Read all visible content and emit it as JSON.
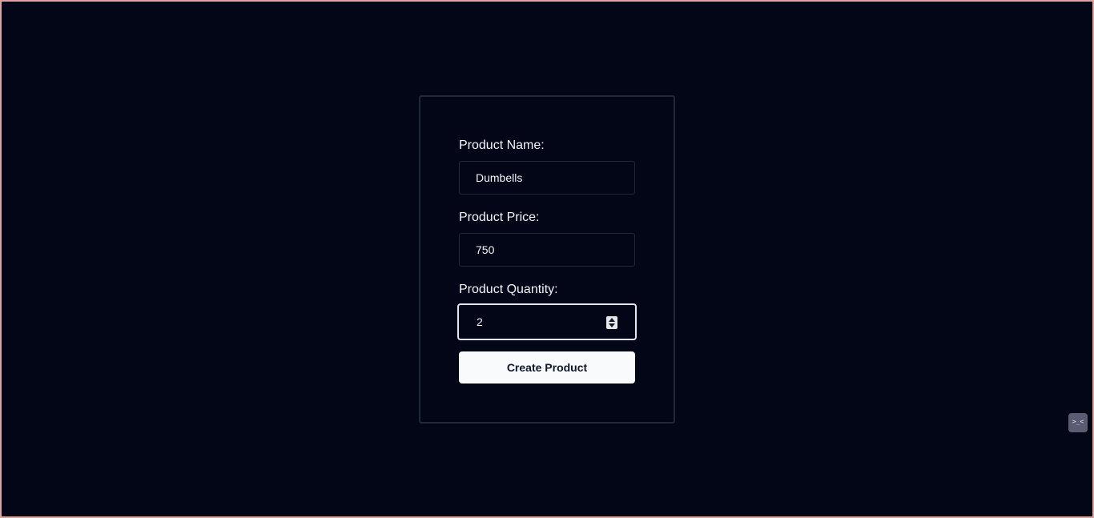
{
  "form": {
    "name_label": "Product Name:",
    "name_value": "Dumbells",
    "price_label": "Product Price:",
    "price_value": "750",
    "quantity_label": "Product Quantity:",
    "quantity_value": "2",
    "submit_label": "Create Product"
  },
  "widget": {
    "glyph": ">_<"
  },
  "colors": {
    "background": "#020617",
    "card_border": "#1f2937",
    "button_bg": "#f8fafc",
    "page_border": "#e0a1a1"
  }
}
